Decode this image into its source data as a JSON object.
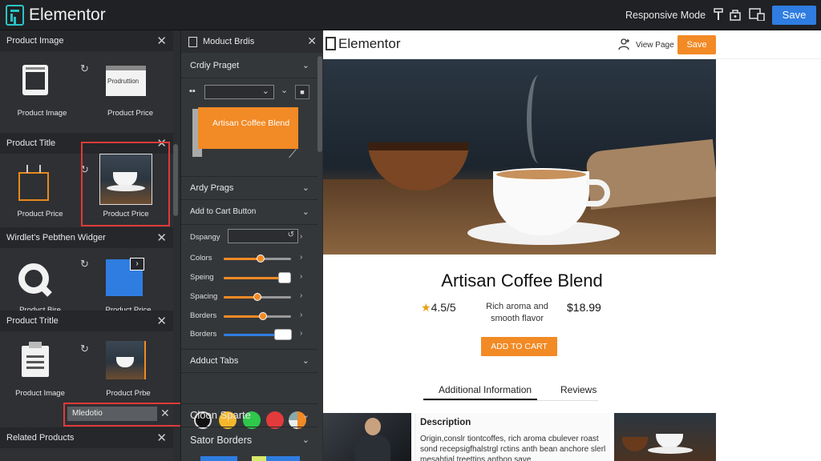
{
  "app": {
    "title": "Elementor"
  },
  "toolbar": {
    "responsive_mode": "Responsive Mode",
    "save_label": "Save"
  },
  "left_panels": [
    {
      "title": "Product Image",
      "tiles": [
        "Product Image",
        "Product Price"
      ],
      "thumb_text": "Prodruttion"
    },
    {
      "title": "Product Title",
      "tiles": [
        "Product Price",
        "Product Price"
      ]
    },
    {
      "title": "Wirdlet's Pebthen Widger",
      "tiles": [
        "Prodvct Bire",
        "Product Price"
      ]
    },
    {
      "title": "Product Tritle",
      "tiles": [
        "Product Image",
        "Product Prbe"
      ],
      "input_value": "Mledotio"
    },
    {
      "title": "Related Products"
    }
  ],
  "settings": {
    "header": "Moduct Brdis",
    "sections": [
      "Crdiy Praget",
      "Ardy Prags",
      "Add to Cart Button"
    ],
    "preview_label": "Artisan Coffee Blend",
    "dispay_label": "Dspangy",
    "controls": [
      {
        "label": "Colors",
        "value": 0.55
      },
      {
        "label": "Speing",
        "value": 0.9
      },
      {
        "label": "Spacing",
        "value": 0.5
      },
      {
        "label": "Borders",
        "value": 0.58
      },
      {
        "label": "Borders",
        "value": 0.88
      }
    ],
    "tabs_section": "Adduct Tabs",
    "bottom_sections": [
      "Cloon Sparte",
      "Sator Borders"
    ],
    "swatch_colors": [
      "#111111",
      "#f5b72a",
      "#2fc84a",
      "#e33b3b",
      "#f28a25"
    ]
  },
  "preview": {
    "logo_text": "Elementor",
    "view_page": "View Page",
    "save_label": "Save",
    "product_title": "Artisan Coffee Blend",
    "rating": "4.5/5",
    "short_desc": "Rich aroma and smooth flavor",
    "price": "$18.99",
    "add_to_cart": "ADD TO CART",
    "tabs": [
      "Additional Information",
      "Reviews"
    ],
    "description_title": "Description",
    "description_text": "Origin,conslr tiontcoffes, rich aroma cbulever roast sond recepsigfhalstrgl rctins anth bean anchore slerl mesahtial treettins anthon save"
  },
  "colors": {
    "accent": "#f28a25",
    "primary": "#2f7de1",
    "highlight": "#e03a3a"
  }
}
